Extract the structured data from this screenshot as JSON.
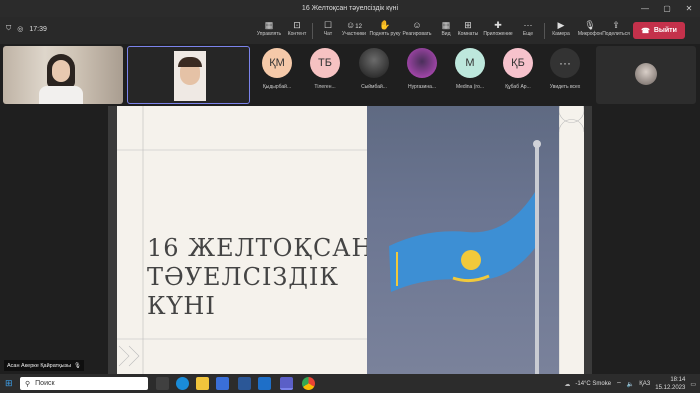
{
  "window": {
    "title": "16 Желтоқсан тәуелсіздік күні"
  },
  "meeting": {
    "timer": "17:39"
  },
  "toolbar": {
    "items": [
      {
        "label": "Управлять",
        "icon": "manage-icon"
      },
      {
        "label": "Контент",
        "icon": "share-content-icon"
      },
      {
        "label": "Чат",
        "icon": "chat-icon"
      },
      {
        "label": "Участники",
        "icon": "participants-icon",
        "badge": "12"
      },
      {
        "label": "Поднять руку",
        "icon": "raise-hand-icon"
      },
      {
        "label": "Реагировать",
        "icon": "react-icon"
      },
      {
        "label": "Вид",
        "icon": "view-icon"
      },
      {
        "label": "Комнаты",
        "icon": "rooms-icon"
      },
      {
        "label": "Приложение",
        "icon": "apps-icon"
      },
      {
        "label": "Еще",
        "icon": "more-icon"
      },
      {
        "label": "Камера",
        "icon": "camera-icon"
      },
      {
        "label": "Микрофон",
        "icon": "microphone-icon"
      },
      {
        "label": "Поделиться",
        "icon": "share-icon"
      }
    ],
    "leave_label": "Выйти"
  },
  "participants": [
    {
      "initials": "ҚМ",
      "name": "Қыдырбай...",
      "color": "#f5c9a9"
    },
    {
      "initials": "ТБ",
      "name": "Тілеген...",
      "color": "#f6c2c2"
    },
    {
      "initials": "",
      "name": "Сыймбай...",
      "color": "#3a3a3a"
    },
    {
      "initials": "",
      "name": "Нургазина...",
      "color": "#c24ec6"
    },
    {
      "initials": "M",
      "name": "Medina (го...",
      "color": "#bde7dc"
    },
    {
      "initials": "ҚБ",
      "name": "Құбаб Ар...",
      "color": "#f6c2cc"
    }
  ],
  "more_participants": {
    "label": "Увидеть всех"
  },
  "self_view": {
    "name": "Асан Акерке Қайратқызы"
  },
  "slide": {
    "title_lines": "16 ЖЕЛТОҚСАН -\nТӘУЕЛСІЗДІК\nКҮНІ"
  },
  "taskbar": {
    "search_placeholder": "Поиск",
    "weather": "-14°C  Smoke",
    "language": "ҚАЗ",
    "time": "18:14",
    "date": "15.12.2023"
  },
  "colors": {
    "leave": "#c4314b",
    "flag_blue": "#3d8fd4",
    "flag_gold": "#f1c93b"
  }
}
